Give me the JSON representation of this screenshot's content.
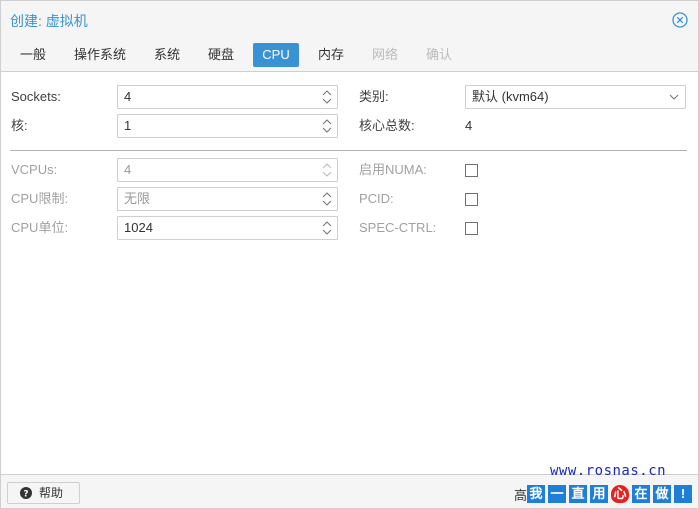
{
  "dialog": {
    "title": "创建: 虚拟机"
  },
  "tabs": [
    {
      "label": "一般",
      "state": "normal"
    },
    {
      "label": "操作系统",
      "state": "normal"
    },
    {
      "label": "系统",
      "state": "normal"
    },
    {
      "label": "硬盘",
      "state": "normal"
    },
    {
      "label": "CPU",
      "state": "active"
    },
    {
      "label": "内存",
      "state": "normal"
    },
    {
      "label": "网络",
      "state": "disabled"
    },
    {
      "label": "确认",
      "state": "disabled"
    }
  ],
  "form": {
    "sockets": {
      "label": "Sockets:",
      "value": "4"
    },
    "cores": {
      "label": "核:",
      "value": "1"
    },
    "type": {
      "label": "类别:",
      "value": "默认 (kvm64)"
    },
    "total_cores": {
      "label": "核心总数:",
      "value": "4"
    },
    "vcpus": {
      "label": "VCPUs:",
      "value": "4"
    },
    "cpu_limit": {
      "label": "CPU限制:",
      "value": "无限"
    },
    "cpu_units": {
      "label": "CPU单位:",
      "value": "1024"
    },
    "numa": {
      "label": "启用NUMA:",
      "checked": false
    },
    "pcid": {
      "label": "PCID:",
      "checked": false
    },
    "spec_ctrl": {
      "label": "SPEC-CTRL:",
      "checked": false
    }
  },
  "footer": {
    "help_label": "帮助",
    "advanced_label": "高"
  },
  "watermark": {
    "url": "www.rosnas.cn",
    "chars": [
      "我",
      "一",
      "直",
      "用",
      "心",
      "在",
      "做",
      "!"
    ]
  },
  "colors": {
    "accent": "#3892d4",
    "watermark_blue": "#1f7fd6",
    "watermark_red": "#e8201f"
  }
}
